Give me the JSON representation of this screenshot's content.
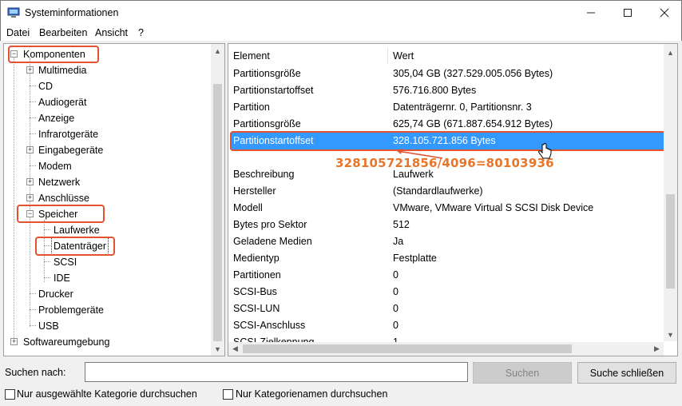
{
  "window": {
    "title": "Systeminformationen"
  },
  "menu": [
    "Datei",
    "Bearbeiten",
    "Ansicht",
    "?"
  ],
  "tree": {
    "komponenten": "Komponenten",
    "multimedia": "Multimedia",
    "cd": "CD",
    "audiogeraet": "Audiogerät",
    "anzeige": "Anzeige",
    "infrarotgeraete": "Infrarotgeräte",
    "eingabegeraete": "Eingabegeräte",
    "modem": "Modem",
    "netzwerk": "Netzwerk",
    "anschluesse": "Anschlüsse",
    "speicher": "Speicher",
    "laufwerke": "Laufwerke",
    "datentraeger": "Datenträger",
    "scsi": "SCSI",
    "ide": "IDE",
    "drucker": "Drucker",
    "problemgeraete": "Problemgeräte",
    "usb": "USB",
    "softwareumgebung": "Softwareumgebung",
    "expand_symbol": "+",
    "collapse_symbol": "−"
  },
  "details": {
    "col_element": "Element",
    "col_wert": "Wert",
    "rows": [
      {
        "element": "Partitionsgröße",
        "wert": "305,04 GB (327.529.005.056 Bytes)"
      },
      {
        "element": "Partitionstartoffset",
        "wert": "576.716.800 Bytes"
      },
      {
        "element": "Partition",
        "wert": "Datenträgernr. 0, Partitionsnr. 3"
      },
      {
        "element": "Partitionsgröße",
        "wert": "625,74 GB (671.887.654.912 Bytes)"
      },
      {
        "element": "Partitionstartoffset",
        "wert": "328.105.721.856 Bytes"
      },
      {
        "element": "",
        "wert": ""
      },
      {
        "element": "Beschreibung",
        "wert": "Laufwerk"
      },
      {
        "element": "Hersteller",
        "wert": "(Standardlaufwerke)"
      },
      {
        "element": "Modell",
        "wert": "VMware, VMware Virtual S SCSI Disk Device"
      },
      {
        "element": "Bytes pro Sektor",
        "wert": "512"
      },
      {
        "element": "Geladene Medien",
        "wert": "Ja"
      },
      {
        "element": "Medientyp",
        "wert": "Festplatte"
      },
      {
        "element": "Partitionen",
        "wert": "0"
      },
      {
        "element": "SCSI-Bus",
        "wert": "0"
      },
      {
        "element": "SCSI-LUN",
        "wert": "0"
      },
      {
        "element": "SCSI-Anschluss",
        "wert": "0"
      },
      {
        "element": "SCSI-Zielkennung",
        "wert": "1"
      }
    ],
    "annotation": "328105721856/4096=80103936"
  },
  "search": {
    "label": "Suchen nach:",
    "value": "",
    "search_button": "Suchen",
    "close_search_button": "Suche schließen",
    "only_selected_category": "Nur ausgewählte Kategorie durchsuchen",
    "only_category_names": "Nur Kategorienamen durchsuchen"
  },
  "colors": {
    "selection": "#3399ff",
    "annotation": "#e8762a",
    "markup": "#e2522f"
  }
}
